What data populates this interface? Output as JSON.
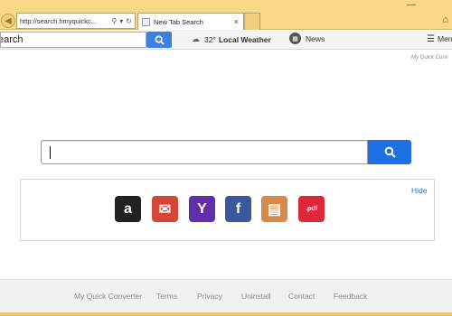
{
  "browser": {
    "address": "http://search.hmyquickc...",
    "tab_title": "New Tab Search",
    "tab_close": "×",
    "minimize": "—",
    "home_icon": "home-icon"
  },
  "topbar": {
    "search_value": "earch",
    "weather_temp": "32°",
    "weather_label": "Local Weather",
    "news_label": "News",
    "menu_label": "Menu"
  },
  "brand_tag": "My Quick Conv",
  "main": {
    "search_value": ""
  },
  "apps": {
    "hide_label": "Hide",
    "items": [
      {
        "name": "amazon",
        "glyph": "a",
        "color": "#222222"
      },
      {
        "name": "gmail",
        "glyph": "✉",
        "color": "#d44638"
      },
      {
        "name": "yahoo",
        "glyph": "Y",
        "color": "#5f2ea8"
      },
      {
        "name": "facebook",
        "glyph": "f",
        "color": "#3b5998"
      },
      {
        "name": "docs",
        "glyph": "▤",
        "color": "#d9894a"
      },
      {
        "name": "pdf",
        "glyph": ".pdf",
        "color": "#e0263a"
      }
    ]
  },
  "footer": {
    "links": [
      "My Quick Converter",
      "Terms",
      "Privacy",
      "Uninstall",
      "Contact",
      "Feedback"
    ]
  },
  "colors": {
    "accent": "#1f6fe6",
    "chrome": "#f7d888"
  }
}
